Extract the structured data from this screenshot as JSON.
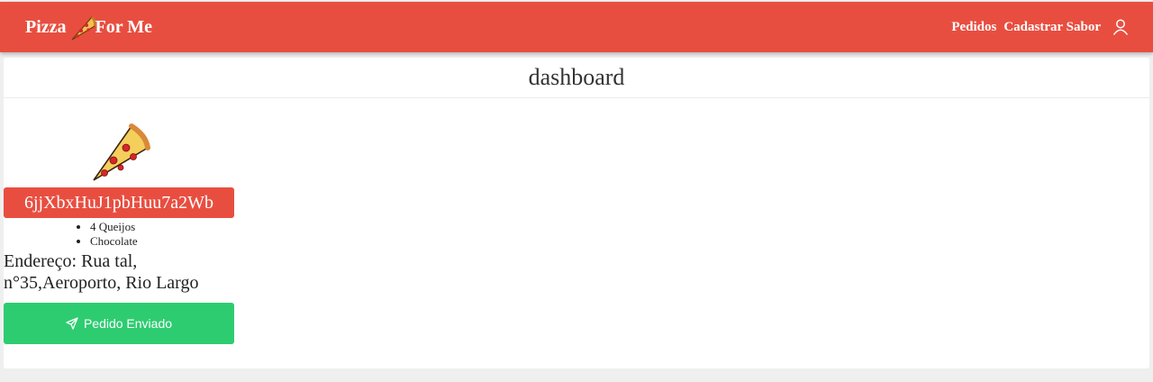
{
  "navbar": {
    "brand_left": "Pizza",
    "brand_right": "For Me",
    "links": [
      "Pedidos",
      "Cadastrar Sabor"
    ],
    "user_icon": "user-icon",
    "color": "#e84e40"
  },
  "page": {
    "title": "dashboard"
  },
  "order": {
    "id": "6jjXbxHuJ1pbHuu7a2Wb",
    "flavors": [
      "4 Queijos",
      "Chocolate"
    ],
    "address": "Endereço: Rua tal, n°35,Aeroporto, Rio Largo",
    "button_label": "Pedido Enviado",
    "button_icon": "send-icon",
    "button_color": "#2ecc71"
  }
}
